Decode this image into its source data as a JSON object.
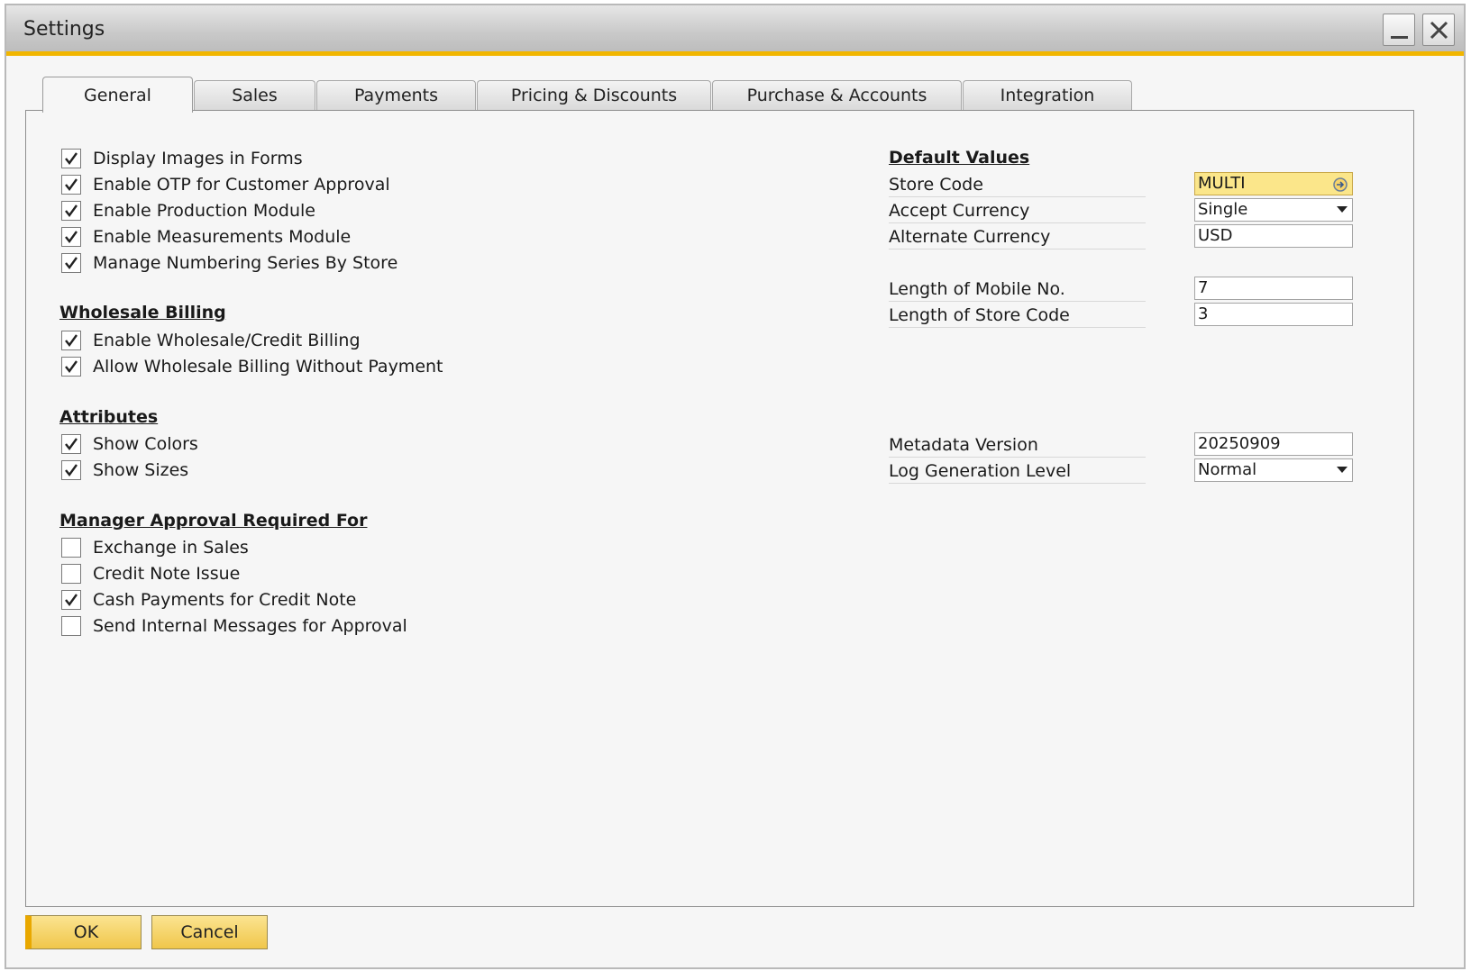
{
  "window": {
    "title": "Settings"
  },
  "tabs": [
    {
      "label": "General",
      "active": true
    },
    {
      "label": "Sales",
      "active": false
    },
    {
      "label": "Payments",
      "active": false
    },
    {
      "label": "Pricing & Discounts",
      "active": false
    },
    {
      "label": "Purchase & Accounts",
      "active": false
    },
    {
      "label": "Integration",
      "active": false
    }
  ],
  "general": {
    "options": [
      {
        "label": "Display Images in Forms",
        "checked": true
      },
      {
        "label": "Enable OTP for Customer Approval",
        "checked": true
      },
      {
        "label": "Enable Production Module",
        "checked": true
      },
      {
        "label": "Enable Measurements Module",
        "checked": true
      },
      {
        "label": "Manage Numbering Series By Store",
        "checked": true
      }
    ]
  },
  "wholesale": {
    "heading": "Wholesale Billing",
    "options": [
      {
        "label": "Enable Wholesale/Credit Billing",
        "checked": true
      },
      {
        "label": "Allow Wholesale Billing Without Payment",
        "checked": true
      }
    ]
  },
  "attributes": {
    "heading": "Attributes",
    "options": [
      {
        "label": "Show Colors",
        "checked": true
      },
      {
        "label": "Show Sizes",
        "checked": true
      }
    ]
  },
  "approval": {
    "heading": "Manager Approval Required For",
    "options": [
      {
        "label": "Exchange in Sales",
        "checked": false
      },
      {
        "label": "Credit Note Issue",
        "checked": false
      },
      {
        "label": "Cash Payments for Credit Note",
        "checked": true
      },
      {
        "label": "Send Internal Messages for Approval",
        "checked": false
      }
    ]
  },
  "defaults": {
    "heading": "Default Values",
    "store_code": {
      "label": "Store Code",
      "value": "MULTI"
    },
    "accept_currency": {
      "label": "Accept Currency",
      "value": "Single"
    },
    "alternate_currency": {
      "label": "Alternate Currency",
      "value": "USD"
    },
    "mobile_length": {
      "label": "Length of Mobile No.",
      "value": "7"
    },
    "store_code_length": {
      "label": "Length of Store Code",
      "value": "3"
    },
    "metadata_version": {
      "label": "Metadata Version",
      "value": "20250909"
    },
    "log_level": {
      "label": "Log Generation Level",
      "value": "Normal"
    }
  },
  "buttons": {
    "ok": "OK",
    "cancel": "Cancel"
  },
  "colors": {
    "accent": "#f1b600",
    "highlight_field": "#fbe68a",
    "button": "#f0c64a"
  }
}
